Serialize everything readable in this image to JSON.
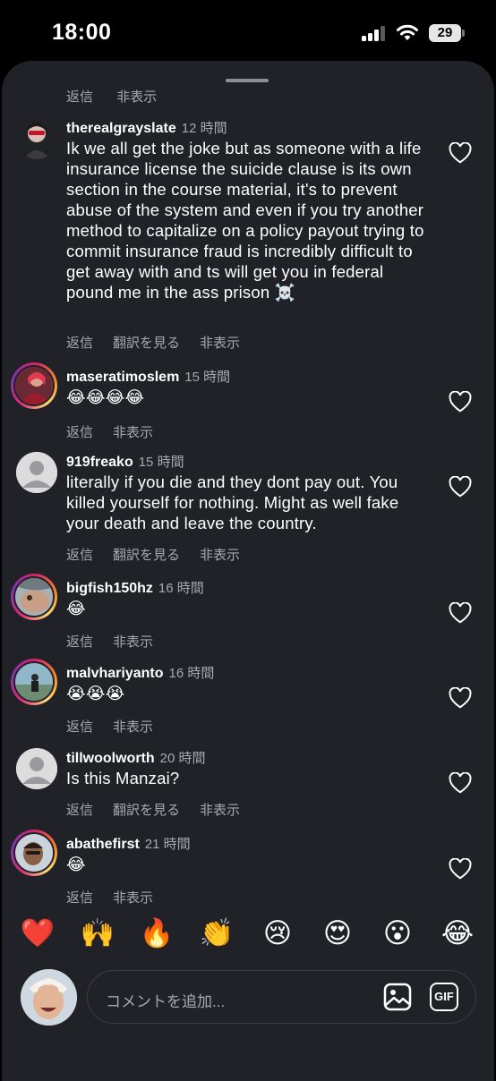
{
  "status_bar": {
    "time": "18:00",
    "battery": "29"
  },
  "sheet": {
    "cut_actions": [
      "返信",
      "非表示"
    ]
  },
  "comments": [
    {
      "user": "therealgrayslate",
      "ago": "12 時間",
      "text": "Ik we all get the joke but as someone with a life insurance license the suicide clause is its own section in the course material, it's to prevent abuse of the system and even if you try another method to capitalize on a policy payout trying to commit insurance fraud is incredibly difficult to get away with and ts will get you in federal pound me in the ass prison ☠️",
      "actions": [
        "返信",
        "翻訳を見る",
        "非表示"
      ]
    },
    {
      "user": "maseratimoslem",
      "ago": "15 時間",
      "text": "😂😂😂😂",
      "actions": [
        "返信",
        "非表示"
      ]
    },
    {
      "user": "919freako",
      "ago": "15 時間",
      "text": "literally if you die and they dont pay out. You killed yourself for nothing. Might as well fake your death and leave the country.",
      "actions": [
        "返信",
        "翻訳を見る",
        "非表示"
      ]
    },
    {
      "user": "bigfish150hz",
      "ago": "16 時間",
      "text": "😂",
      "actions": [
        "返信",
        "非表示"
      ]
    },
    {
      "user": "malvhariyanto",
      "ago": "16 時間",
      "text": "😭😭😭",
      "actions": [
        "返信",
        "非表示"
      ]
    },
    {
      "user": "tillwoolworth",
      "ago": "20 時間",
      "text": "Is this Manzai?",
      "actions": [
        "返信",
        "翻訳を見る",
        "非表示"
      ]
    },
    {
      "user": "abathefirst",
      "ago": "21 時間",
      "text": "😂",
      "actions": [
        "返信",
        "非表示"
      ]
    }
  ],
  "reactions": [
    "❤️",
    "🙌",
    "🔥",
    "👏",
    "😢",
    "😍",
    "😮",
    "😂"
  ],
  "composer": {
    "placeholder": "コメントを追加...",
    "gif_label": "GIF"
  },
  "colors": {
    "sheet_bg": "#202227",
    "secondary_text": "#a8a8ad"
  }
}
